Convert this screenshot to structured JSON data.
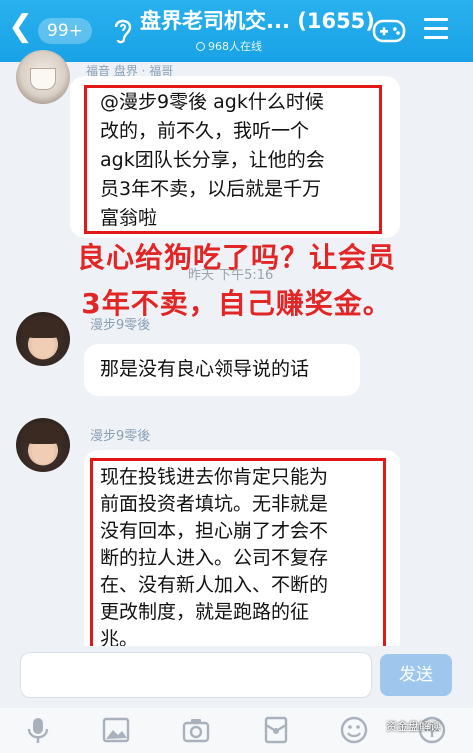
{
  "header": {
    "back_glyph": "❮",
    "unread_badge": "99+",
    "title": "盘界老司机交... (1655)",
    "online": "968人在线",
    "icons": [
      "ear-icon",
      "gamepad-icon",
      "menu-icon"
    ]
  },
  "top_sender": {
    "tag": "福音 盘界 · 福哥"
  },
  "message1": {
    "lines": [
      "@漫步9零後 agk什么时候",
      "改的，前不久，我听一个",
      "agk团队长分享，让他的会",
      "员3年不卖，以后就是千万",
      "富翁啦"
    ]
  },
  "overlay": {
    "line1": "良心给狗吃了吗？让会员",
    "line2": "3年不卖，自己赚奖金。"
  },
  "timestamp": "昨天 下午5:16",
  "message2": {
    "sender": "漫步9零後",
    "text": "那是没有良心领导说的话"
  },
  "message3": {
    "sender": "漫步9零後",
    "lines": [
      "现在投钱进去你肯定只能为",
      "前面投资者填坑。无非就是",
      "没有回本，担心崩了才会不",
      "断的拉人进入。公司不复存",
      "在、没有新人加入、不断的",
      "更改制度，就是跑路的征",
      "兆。"
    ]
  },
  "input": {
    "placeholder": "",
    "send_label": "发送"
  },
  "toolbar": {
    "icons": [
      "microphone-icon",
      "image-icon",
      "camera-icon",
      "red-packet-icon",
      "emoji-icon",
      "plus-icon"
    ]
  },
  "watermark": "资金盘解读",
  "colors": {
    "header": "#1fa8eb",
    "highlight": "#e21818",
    "send_button": "#9fc7ee"
  }
}
